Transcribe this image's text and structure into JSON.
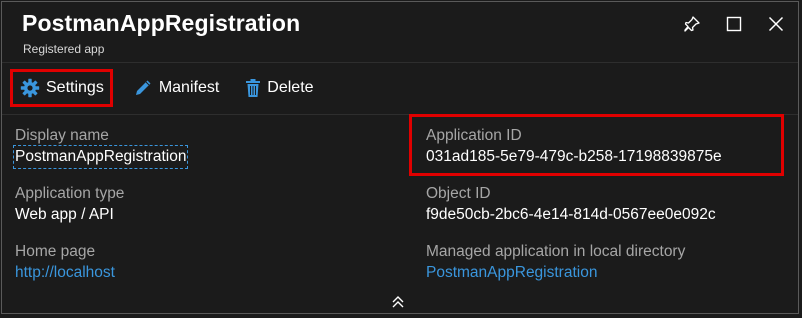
{
  "header": {
    "title": "PostmanAppRegistration",
    "subtitle": "Registered app",
    "icons": [
      "pin-icon",
      "maximize-icon",
      "close-icon"
    ]
  },
  "toolbar": {
    "settings_label": "Settings",
    "manifest_label": "Manifest",
    "delete_label": "Delete"
  },
  "essentials": {
    "display_name": {
      "label": "Display name",
      "value": "PostmanAppRegistration"
    },
    "application_type": {
      "label": "Application type",
      "value": "Web app / API"
    },
    "home_page": {
      "label": "Home page",
      "value": "http://localhost"
    },
    "application_id": {
      "label": "Application ID",
      "value": "031ad185-5e79-479c-b258-17198839875e"
    },
    "object_id": {
      "label": "Object ID",
      "value": "f9de50cb-2bc6-4e14-814d-0567ee0e092c"
    },
    "managed_app": {
      "label": "Managed application in local directory",
      "value": "PostmanAppRegistration"
    }
  },
  "colors": {
    "background": "#1b1b1b",
    "link": "#3a96dd",
    "highlight": "#e00000",
    "label": "#a6a6a6"
  }
}
